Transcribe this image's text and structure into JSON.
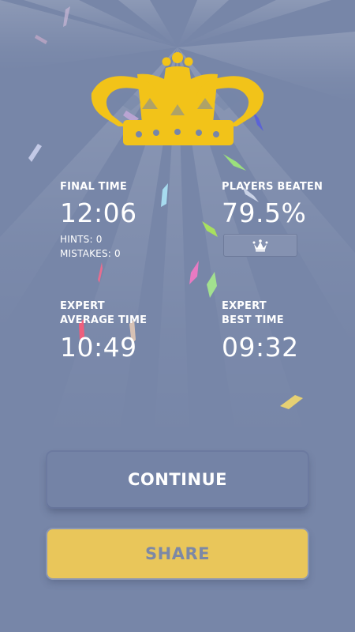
{
  "stats": {
    "final_time": {
      "label": "FINAL TIME",
      "value": "12:06"
    },
    "hints": "HINTS: 0",
    "mistakes": "MISTAKES: 0",
    "players_beaten": {
      "label": "PLAYERS BEATEN",
      "value": "79.5%"
    },
    "average_time": {
      "label_line1": "EXPERT",
      "label_line2": "AVERAGE TIME",
      "value": "10:49"
    },
    "best_time": {
      "label_line1": "EXPERT",
      "label_line2": "BEST TIME",
      "value": "09:32"
    }
  },
  "buttons": {
    "continue_label": "CONTINUE",
    "share_label": "SHARE"
  },
  "icons": {
    "crown": "crown-icon",
    "rank_badge": "crown-icon"
  },
  "colors": {
    "background": "#7786a8",
    "crown_gold": "#f2c319",
    "share_button": "#e9c65a",
    "text": "#ffffff"
  }
}
